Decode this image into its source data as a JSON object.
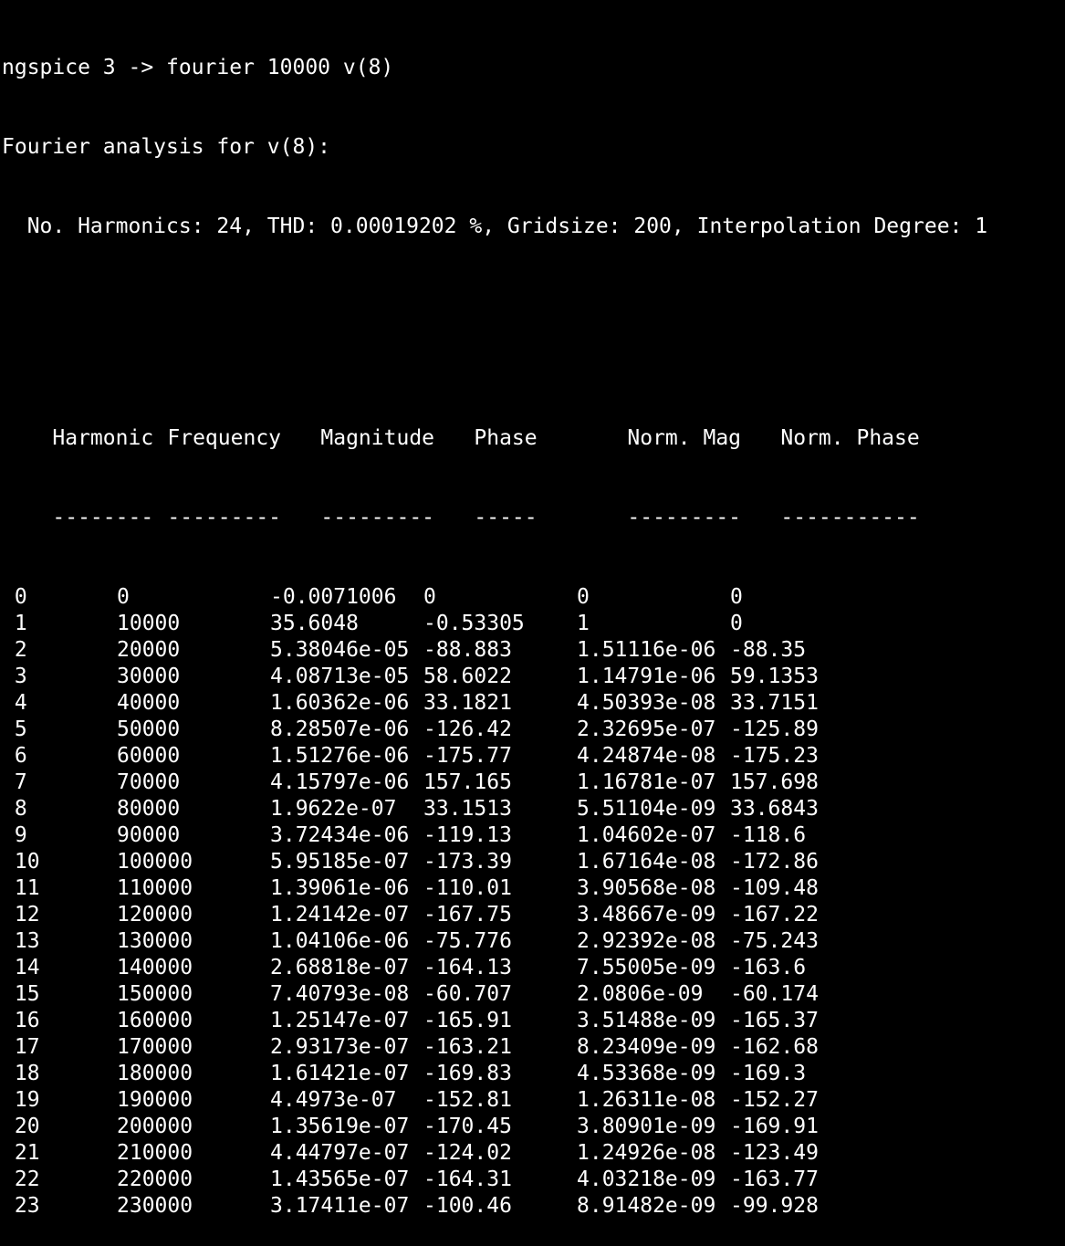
{
  "terminal": {
    "command_line": "ngspice 3 -> fourier 10000 v(8)",
    "analysis_title": "Fourier analysis for v(8):",
    "summary": "  No. Harmonics: 24, THD: 0.00019202 %, Gridsize: 200, Interpolation Degree: 1",
    "blank": "",
    "headers": [
      "Harmonic",
      "Frequency",
      "Magnitude",
      "Phase",
      "Norm. Mag",
      "Norm. Phase"
    ],
    "separators": [
      "--------",
      "---------",
      "---------",
      "-----",
      "---------",
      "-----------"
    ],
    "rows": [
      [
        " 0",
        "0",
        "-0.0071006",
        "0",
        "0",
        "0"
      ],
      [
        " 1",
        "10000",
        "35.6048",
        "-0.53305",
        "1",
        "0"
      ],
      [
        " 2",
        "20000",
        "5.38046e-05",
        "-88.883",
        "1.51116e-06",
        "-88.35"
      ],
      [
        " 3",
        "30000",
        "4.08713e-05",
        "58.6022",
        "1.14791e-06",
        "59.1353"
      ],
      [
        " 4",
        "40000",
        "1.60362e-06",
        "33.1821",
        "4.50393e-08",
        "33.7151"
      ],
      [
        " 5",
        "50000",
        "8.28507e-06",
        "-126.42",
        "2.32695e-07",
        "-125.89"
      ],
      [
        " 6",
        "60000",
        "1.51276e-06",
        "-175.77",
        "4.24874e-08",
        "-175.23"
      ],
      [
        " 7",
        "70000",
        "4.15797e-06",
        "157.165",
        "1.16781e-07",
        "157.698"
      ],
      [
        " 8",
        "80000",
        "1.9622e-07",
        "33.1513",
        "5.51104e-09",
        "33.6843"
      ],
      [
        " 9",
        "90000",
        "3.72434e-06",
        "-119.13",
        "1.04602e-07",
        "-118.6"
      ],
      [
        " 10",
        "100000",
        "5.95185e-07",
        "-173.39",
        "1.67164e-08",
        "-172.86"
      ],
      [
        " 11",
        "110000",
        "1.39061e-06",
        "-110.01",
        "3.90568e-08",
        "-109.48"
      ],
      [
        " 12",
        "120000",
        "1.24142e-07",
        "-167.75",
        "3.48667e-09",
        "-167.22"
      ],
      [
        " 13",
        "130000",
        "1.04106e-06",
        "-75.776",
        "2.92392e-08",
        "-75.243"
      ],
      [
        " 14",
        "140000",
        "2.68818e-07",
        "-164.13",
        "7.55005e-09",
        "-163.6"
      ],
      [
        " 15",
        "150000",
        "7.40793e-08",
        "-60.707",
        "2.0806e-09",
        "-60.174"
      ],
      [
        " 16",
        "160000",
        "1.25147e-07",
        "-165.91",
        "3.51488e-09",
        "-165.37"
      ],
      [
        " 17",
        "170000",
        "2.93173e-07",
        "-163.21",
        "8.23409e-09",
        "-162.68"
      ],
      [
        " 18",
        "180000",
        "1.61421e-07",
        "-169.83",
        "4.53368e-09",
        "-169.3"
      ],
      [
        " 19",
        "190000",
        "4.4973e-07",
        "-152.81",
        "1.26311e-08",
        "-152.27"
      ],
      [
        " 20",
        "200000",
        "1.35619e-07",
        "-170.45",
        "3.80901e-09",
        "-169.91"
      ],
      [
        " 21",
        "210000",
        "4.44797e-07",
        "-124.02",
        "1.24926e-08",
        "-123.49"
      ],
      [
        " 22",
        "220000",
        "1.43565e-07",
        "-164.31",
        "4.03218e-09",
        "-163.77"
      ],
      [
        " 23",
        "230000",
        "3.17411e-07",
        "-100.46",
        "8.91482e-09",
        "-99.928"
      ]
    ]
  },
  "colors": {
    "background": "#000000",
    "foreground": "#ffffff"
  }
}
